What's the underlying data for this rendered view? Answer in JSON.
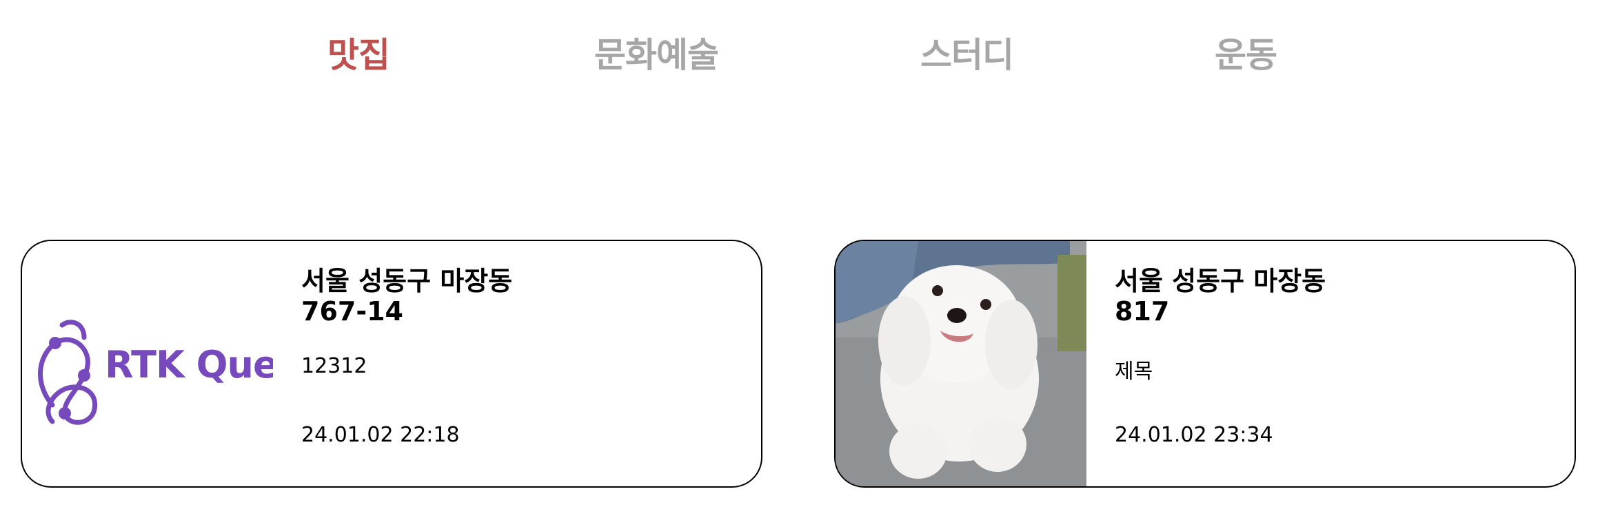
{
  "tabs": [
    {
      "label": "맛집",
      "active": true
    },
    {
      "label": "문화예술",
      "active": false
    },
    {
      "label": "스터디",
      "active": false
    },
    {
      "label": "운동",
      "active": false
    }
  ],
  "colors": {
    "active_tab": "#c0504d",
    "inactive_tab": "#a6a6a6",
    "rtk_purple": "#764abc"
  },
  "cards": [
    {
      "thumbnail": "rtk-query-logo",
      "logo_text": "RTK Query",
      "address": "서울 성동구 마장동\n767-14",
      "title": "12312",
      "date": "24.01.02 22:18"
    },
    {
      "thumbnail": "white-dog-photo",
      "address": "서울 성동구 마장동\n817",
      "title": "제목",
      "date": "24.01.02 23:34"
    }
  ]
}
